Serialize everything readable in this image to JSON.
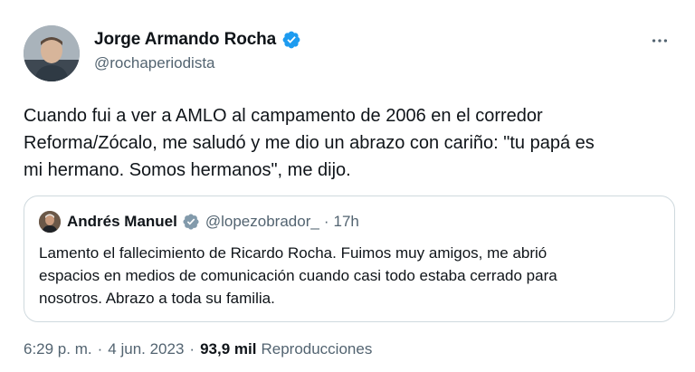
{
  "tweet": {
    "author": {
      "name": "Jorge Armando Rocha",
      "handle": "@rochaperiodista",
      "verified": true
    },
    "text_lines": [
      "Cuando fui a ver a AMLO al campamento de 2006 en el corredor",
      "Reforma/Zócalo, me saludó y me dio un abrazo con cariño: \"tu papá es",
      "mi hermano. Somos hermanos\", me dijo."
    ],
    "more_icon": "more-horizontal-icon",
    "quote": {
      "author_name": "Andrés Manuel",
      "verified": true,
      "handle": "@lopezobrador_",
      "separator": "·",
      "time": "17h",
      "text_lines": [
        "Lamento el fallecimiento de Ricardo Rocha. Fuimos muy amigos, me abrió",
        "espacios en medios de comunicación cuando casi todo estaba cerrado para",
        "nosotros. Abrazo a toda su familia."
      ]
    },
    "meta": {
      "time": "6:29 p. m.",
      "separator": "·",
      "date": "4 jun. 2023",
      "views_count": "93,9 mil",
      "views_label": "Reproducciones"
    }
  },
  "colors": {
    "verified_badge": "#1d9bf0",
    "verified_badge_gray": "#829aab",
    "secondary_text": "#536471",
    "border": "#cfd9de"
  }
}
